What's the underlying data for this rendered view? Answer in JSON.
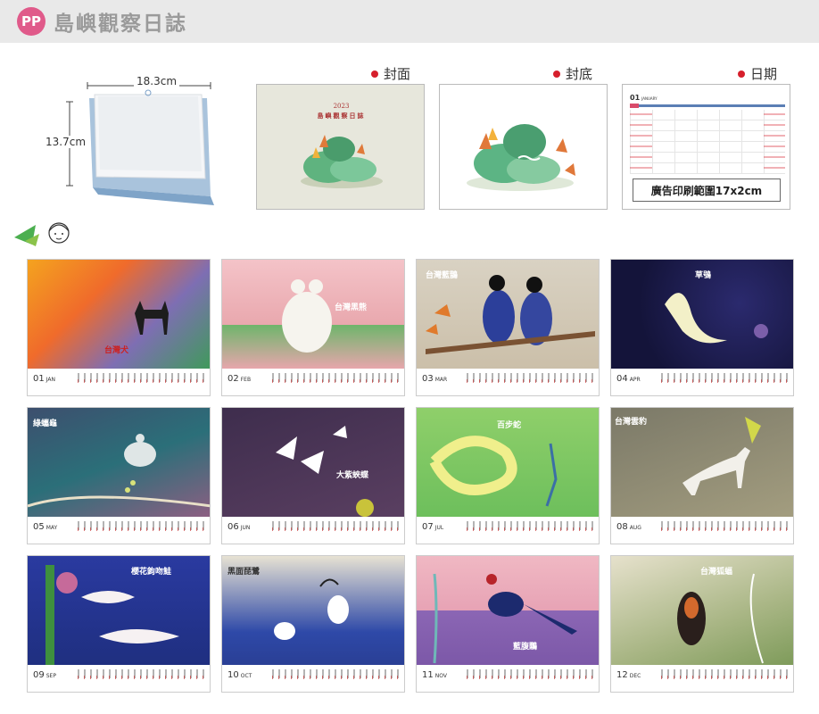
{
  "header": {
    "badge": "PP",
    "title": "島嶼觀察日誌"
  },
  "dimensions": {
    "width": "18.3cm",
    "height": "13.7cm"
  },
  "sections": {
    "cover": "封面",
    "back": "封底",
    "date": "日期"
  },
  "cover": {
    "year": "2023",
    "title": "島嶼觀察日誌"
  },
  "date_page": {
    "month_num": "01",
    "month_name": "JANUARY",
    "ad_area": "廣告印刷範圍17x2cm"
  },
  "months": [
    {
      "num": "01",
      "abbr": "JAN",
      "title": "台灣犬"
    },
    {
      "num": "02",
      "abbr": "FEB",
      "title": "台灣黑熊"
    },
    {
      "num": "03",
      "abbr": "MAR",
      "title": "台灣藍鵲"
    },
    {
      "num": "04",
      "abbr": "APR",
      "title": "草鴞"
    },
    {
      "num": "05",
      "abbr": "MAY",
      "title": "綠蠵龜"
    },
    {
      "num": "06",
      "abbr": "JUN",
      "title": "大紫蛺蝶"
    },
    {
      "num": "07",
      "abbr": "JUL",
      "title": "百步蛇"
    },
    {
      "num": "08",
      "abbr": "AUG",
      "title": "台灣雲豹"
    },
    {
      "num": "09",
      "abbr": "SEP",
      "title": "櫻花鉤吻鮭"
    },
    {
      "num": "10",
      "abbr": "OCT",
      "title": "黑面琵鷺"
    },
    {
      "num": "11",
      "abbr": "NOV",
      "title": "藍腹鷴"
    },
    {
      "num": "12",
      "abbr": "DEC",
      "title": "台灣狐蝠"
    }
  ],
  "colors": {
    "accent": "#d61f2c",
    "badge": "#e05a8a"
  }
}
